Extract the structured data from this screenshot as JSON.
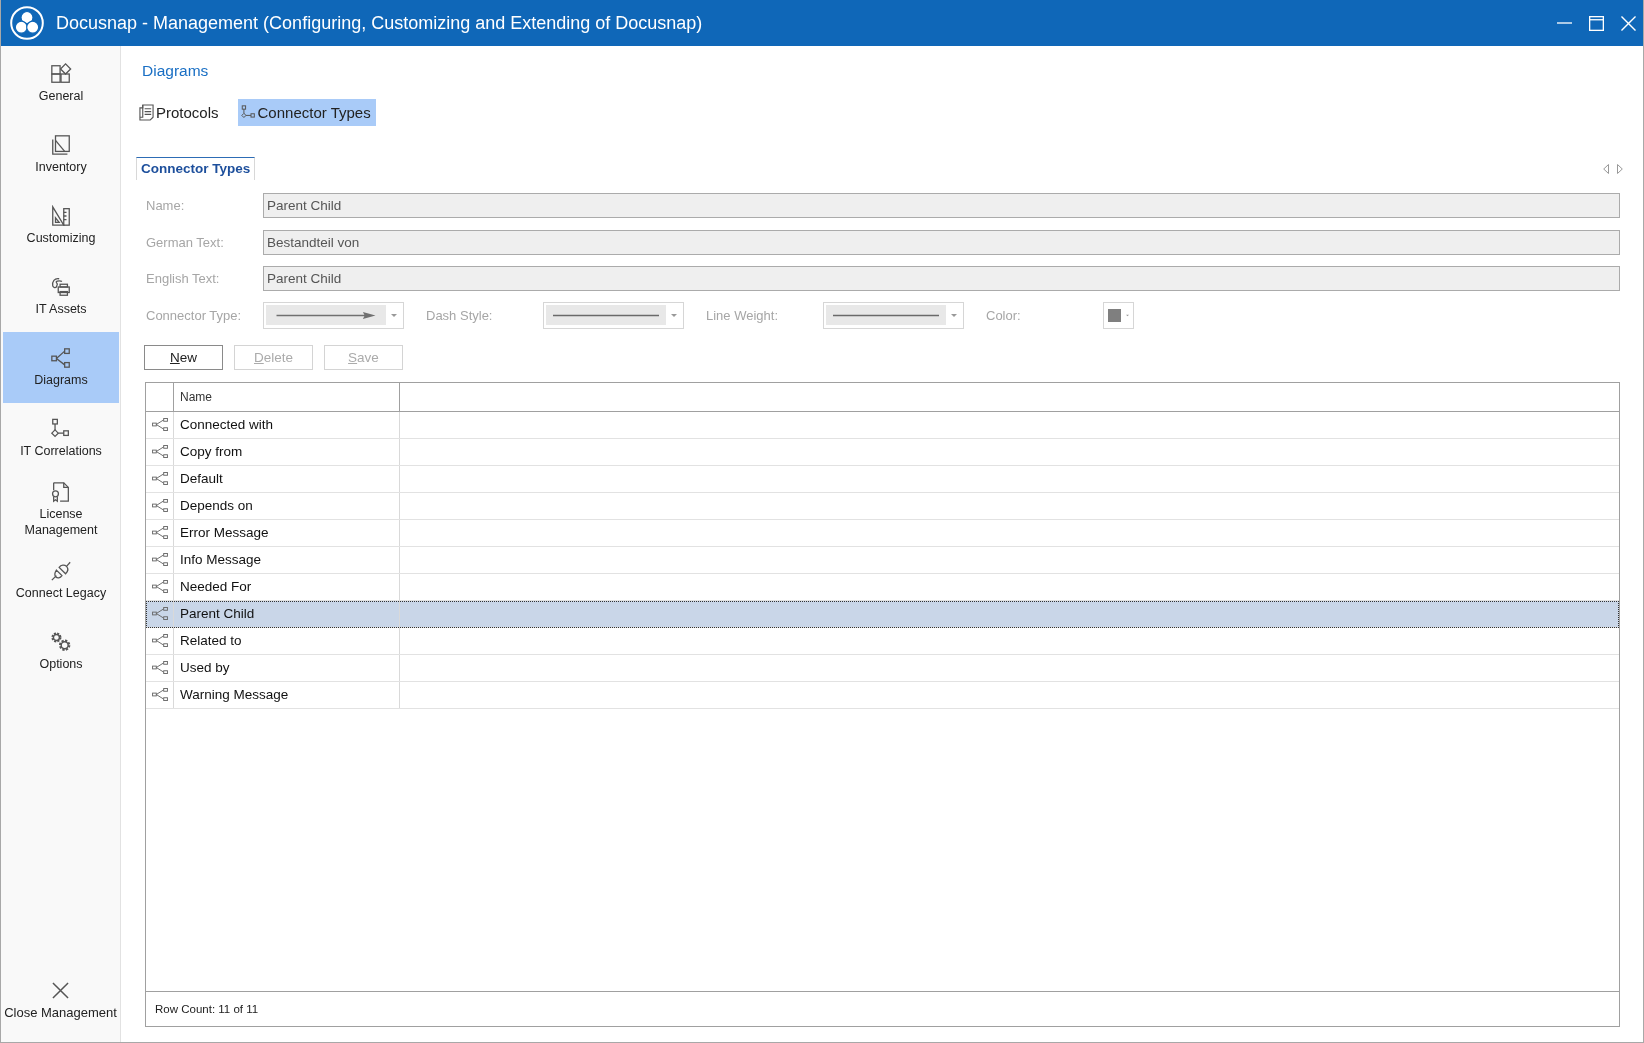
{
  "window": {
    "title": "Docusnap - Management (Configuring, Customizing and Extending of Docusnap)"
  },
  "sidebar": {
    "items": [
      {
        "label": "General",
        "selected": false
      },
      {
        "label": "Inventory",
        "selected": false
      },
      {
        "label": "Customizing",
        "selected": false
      },
      {
        "label": "IT Assets",
        "selected": false
      },
      {
        "label": "Diagrams",
        "selected": true
      },
      {
        "label": "IT Correlations",
        "selected": false
      },
      {
        "label": "License Management",
        "selected": false
      },
      {
        "label": "Connect Legacy",
        "selected": false
      },
      {
        "label": "Options",
        "selected": false
      }
    ],
    "footer_item": {
      "label": "Close Management"
    }
  },
  "page": {
    "heading": "Diagrams"
  },
  "toolbar": {
    "items": [
      {
        "label": "Protocols",
        "selected": false
      },
      {
        "label": "Connector Types",
        "selected": true
      }
    ]
  },
  "tabs": [
    {
      "label": "Connector Types",
      "selected": true
    }
  ],
  "form": {
    "fields": [
      {
        "label": "Name:",
        "value": "Parent Child",
        "disabled": true
      },
      {
        "label": "German Text:",
        "value": "Bestandteil von",
        "disabled": true
      },
      {
        "label": "English Text:",
        "value": "Parent Child",
        "disabled": true
      }
    ],
    "options": [
      {
        "label": "Connector Type:",
        "kind": "connector",
        "disabled": true
      },
      {
        "label": "Dash Style:",
        "kind": "dash",
        "disabled": true
      },
      {
        "label": "Line Weight:",
        "kind": "weight",
        "disabled": true
      },
      {
        "label": "Color:",
        "kind": "color",
        "color": "#7f7f7f",
        "disabled": true
      }
    ]
  },
  "buttons": [
    {
      "label": "New",
      "disabled": false,
      "mnemonic": true
    },
    {
      "label": "Delete",
      "disabled": true,
      "mnemonic": true
    },
    {
      "label": "Save",
      "disabled": true,
      "mnemonic": true
    }
  ],
  "table": {
    "columns": [
      "Name"
    ],
    "rows": [
      {
        "name": "Connected with",
        "selected": false
      },
      {
        "name": "Copy from",
        "selected": false
      },
      {
        "name": "Default",
        "selected": false
      },
      {
        "name": "Depends on",
        "selected": false
      },
      {
        "name": "Error Message",
        "selected": false
      },
      {
        "name": "Info Message",
        "selected": false
      },
      {
        "name": "Needed For",
        "selected": false
      },
      {
        "name": "Parent Child",
        "selected": true
      },
      {
        "name": "Related to",
        "selected": false
      },
      {
        "name": "Used by",
        "selected": false
      },
      {
        "name": "Warning Message",
        "selected": false
      }
    ],
    "footer": "Row Count: 11 of 11"
  }
}
